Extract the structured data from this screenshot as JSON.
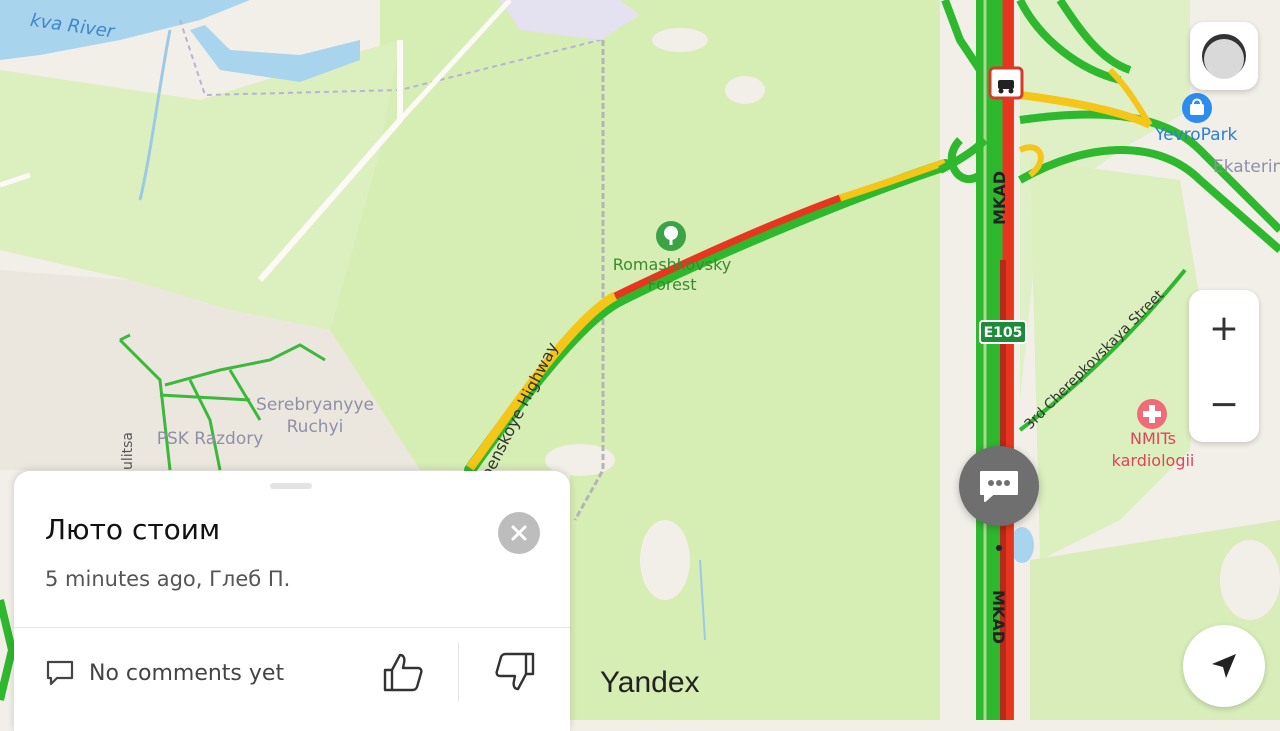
{
  "map": {
    "labels": {
      "river": "kva River",
      "romashkovsky": "Romashkovsky",
      "forest": "Forest",
      "highway": "penskoye Highway",
      "serebryanyye": "Serebryanyye",
      "ruchyi": "Ruchyi",
      "psk": "PSK Razdory",
      "ulitsa": "ulitsa",
      "mkad_top": "MKAD",
      "mkad_bottom": "MKAD",
      "e105": "E105",
      "yevropark": "YevroPark",
      "ekaterin": "Ekaterin",
      "cherepkovskaya": "3rd Cherepkovskaya Street",
      "nmits": "NMITs",
      "kardiologii": "kardiologii",
      "watermark": "Yandex"
    },
    "traffic_colors": {
      "free": "#2eb82e",
      "medium": "#f5c518",
      "jam": "#e8361e",
      "stopped": "#b52a1a"
    }
  },
  "controls": {
    "zoom_in": "+",
    "zoom_out": "−"
  },
  "card": {
    "title": "Люто стоим",
    "meta": "5 minutes ago, Глеб П.",
    "comments": "No comments yet"
  }
}
